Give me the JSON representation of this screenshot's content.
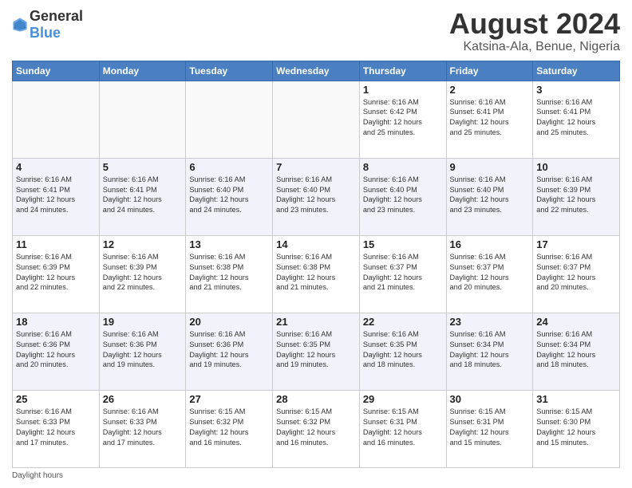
{
  "logo": {
    "text1": "General",
    "text2": "Blue"
  },
  "title": "August 2024",
  "subtitle": "Katsina-Ala, Benue, Nigeria",
  "days_of_week": [
    "Sunday",
    "Monday",
    "Tuesday",
    "Wednesday",
    "Thursday",
    "Friday",
    "Saturday"
  ],
  "daylight_note": "Daylight hours",
  "weeks": [
    [
      {
        "day": "",
        "info": ""
      },
      {
        "day": "",
        "info": ""
      },
      {
        "day": "",
        "info": ""
      },
      {
        "day": "",
        "info": ""
      },
      {
        "day": "1",
        "info": "Sunrise: 6:16 AM\nSunset: 6:42 PM\nDaylight: 12 hours\nand 25 minutes."
      },
      {
        "day": "2",
        "info": "Sunrise: 6:16 AM\nSunset: 6:41 PM\nDaylight: 12 hours\nand 25 minutes."
      },
      {
        "day": "3",
        "info": "Sunrise: 6:16 AM\nSunset: 6:41 PM\nDaylight: 12 hours\nand 25 minutes."
      }
    ],
    [
      {
        "day": "4",
        "info": "Sunrise: 6:16 AM\nSunset: 6:41 PM\nDaylight: 12 hours\nand 24 minutes."
      },
      {
        "day": "5",
        "info": "Sunrise: 6:16 AM\nSunset: 6:41 PM\nDaylight: 12 hours\nand 24 minutes."
      },
      {
        "day": "6",
        "info": "Sunrise: 6:16 AM\nSunset: 6:40 PM\nDaylight: 12 hours\nand 24 minutes."
      },
      {
        "day": "7",
        "info": "Sunrise: 6:16 AM\nSunset: 6:40 PM\nDaylight: 12 hours\nand 23 minutes."
      },
      {
        "day": "8",
        "info": "Sunrise: 6:16 AM\nSunset: 6:40 PM\nDaylight: 12 hours\nand 23 minutes."
      },
      {
        "day": "9",
        "info": "Sunrise: 6:16 AM\nSunset: 6:40 PM\nDaylight: 12 hours\nand 23 minutes."
      },
      {
        "day": "10",
        "info": "Sunrise: 6:16 AM\nSunset: 6:39 PM\nDaylight: 12 hours\nand 22 minutes."
      }
    ],
    [
      {
        "day": "11",
        "info": "Sunrise: 6:16 AM\nSunset: 6:39 PM\nDaylight: 12 hours\nand 22 minutes."
      },
      {
        "day": "12",
        "info": "Sunrise: 6:16 AM\nSunset: 6:39 PM\nDaylight: 12 hours\nand 22 minutes."
      },
      {
        "day": "13",
        "info": "Sunrise: 6:16 AM\nSunset: 6:38 PM\nDaylight: 12 hours\nand 21 minutes."
      },
      {
        "day": "14",
        "info": "Sunrise: 6:16 AM\nSunset: 6:38 PM\nDaylight: 12 hours\nand 21 minutes."
      },
      {
        "day": "15",
        "info": "Sunrise: 6:16 AM\nSunset: 6:37 PM\nDaylight: 12 hours\nand 21 minutes."
      },
      {
        "day": "16",
        "info": "Sunrise: 6:16 AM\nSunset: 6:37 PM\nDaylight: 12 hours\nand 20 minutes."
      },
      {
        "day": "17",
        "info": "Sunrise: 6:16 AM\nSunset: 6:37 PM\nDaylight: 12 hours\nand 20 minutes."
      }
    ],
    [
      {
        "day": "18",
        "info": "Sunrise: 6:16 AM\nSunset: 6:36 PM\nDaylight: 12 hours\nand 20 minutes."
      },
      {
        "day": "19",
        "info": "Sunrise: 6:16 AM\nSunset: 6:36 PM\nDaylight: 12 hours\nand 19 minutes."
      },
      {
        "day": "20",
        "info": "Sunrise: 6:16 AM\nSunset: 6:36 PM\nDaylight: 12 hours\nand 19 minutes."
      },
      {
        "day": "21",
        "info": "Sunrise: 6:16 AM\nSunset: 6:35 PM\nDaylight: 12 hours\nand 19 minutes."
      },
      {
        "day": "22",
        "info": "Sunrise: 6:16 AM\nSunset: 6:35 PM\nDaylight: 12 hours\nand 18 minutes."
      },
      {
        "day": "23",
        "info": "Sunrise: 6:16 AM\nSunset: 6:34 PM\nDaylight: 12 hours\nand 18 minutes."
      },
      {
        "day": "24",
        "info": "Sunrise: 6:16 AM\nSunset: 6:34 PM\nDaylight: 12 hours\nand 18 minutes."
      }
    ],
    [
      {
        "day": "25",
        "info": "Sunrise: 6:16 AM\nSunset: 6:33 PM\nDaylight: 12 hours\nand 17 minutes."
      },
      {
        "day": "26",
        "info": "Sunrise: 6:16 AM\nSunset: 6:33 PM\nDaylight: 12 hours\nand 17 minutes."
      },
      {
        "day": "27",
        "info": "Sunrise: 6:15 AM\nSunset: 6:32 PM\nDaylight: 12 hours\nand 16 minutes."
      },
      {
        "day": "28",
        "info": "Sunrise: 6:15 AM\nSunset: 6:32 PM\nDaylight: 12 hours\nand 16 minutes."
      },
      {
        "day": "29",
        "info": "Sunrise: 6:15 AM\nSunset: 6:31 PM\nDaylight: 12 hours\nand 16 minutes."
      },
      {
        "day": "30",
        "info": "Sunrise: 6:15 AM\nSunset: 6:31 PM\nDaylight: 12 hours\nand 15 minutes."
      },
      {
        "day": "31",
        "info": "Sunrise: 6:15 AM\nSunset: 6:30 PM\nDaylight: 12 hours\nand 15 minutes."
      }
    ]
  ]
}
